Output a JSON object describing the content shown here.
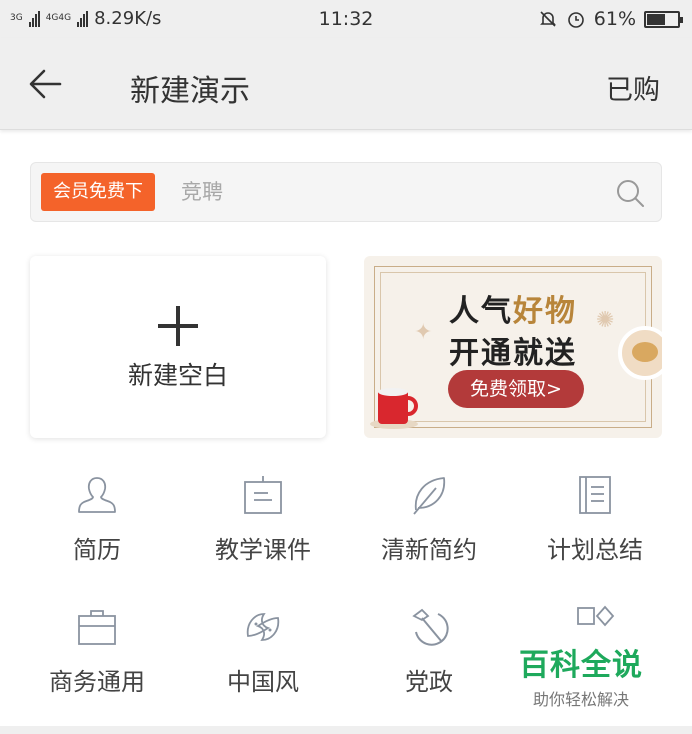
{
  "status_bar": {
    "net1": "3G",
    "net2": "4G4G",
    "speed": "8.29K/s",
    "time": "11:32",
    "battery": "61%",
    "battery_level": 0.61
  },
  "header": {
    "title": "新建演示",
    "bought": "已购"
  },
  "search": {
    "vip_tag": "会员免费下",
    "placeholder": "竞聘"
  },
  "new_blank": {
    "label": "新建空白"
  },
  "banner": {
    "line1_a": "人气",
    "line1_b": "好物",
    "line2": "开通就送",
    "button": "免费领取>"
  },
  "categories": [
    {
      "label": "简历",
      "icon": "person-icon"
    },
    {
      "label": "教学课件",
      "icon": "board-icon"
    },
    {
      "label": "清新简约",
      "icon": "leaf-icon"
    },
    {
      "label": "计划总结",
      "icon": "notebook-icon"
    },
    {
      "label": "商务通用",
      "icon": "briefcase-icon"
    },
    {
      "label": "中国风",
      "icon": "fish-icon"
    },
    {
      "label": "党政",
      "icon": "hammer-sickle-icon"
    },
    {
      "label": "",
      "icon": "shapes-icon"
    }
  ],
  "watermark": {
    "title": "百科全说",
    "subtitle": "助你轻松解决"
  },
  "colors": {
    "accent": "#f4632a",
    "banner_button": "#b33a3a",
    "watermark": "#1ea95c"
  }
}
